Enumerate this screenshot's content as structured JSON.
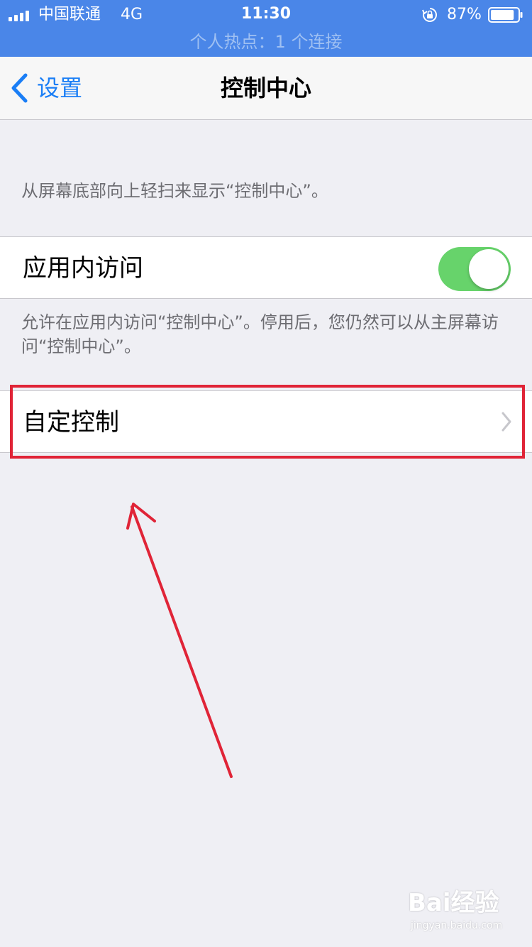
{
  "status_bar": {
    "carrier": "中国联通",
    "network": "4G",
    "time": "11:30",
    "battery_percent": "87%",
    "battery_level": 0.87,
    "hotspot_text": "个人热点：1 个连接",
    "icons": [
      "signal-icon",
      "rotation-lock-icon",
      "battery-icon"
    ]
  },
  "nav_bar": {
    "back_label": "设置",
    "title": "控制中心",
    "back_icon": "chevron-left-icon"
  },
  "content": {
    "header_note": "从屏幕底部向上轻扫来显示“控制中心”。",
    "access_within_apps": {
      "label": "应用内访问",
      "enabled": true,
      "footer": "允许在应用内访问“控制中心”。停用后，您仍然可以从主屏幕访问“控制中心”。"
    },
    "customize_controls": {
      "label": "自定控制",
      "icon": "chevron-right-icon"
    }
  },
  "colors": {
    "status_bar_bg": "#4a86e8",
    "accent_blue": "#1a7ef6",
    "toggle_on": "#67d36b",
    "background": "#efeff4",
    "annotation_red": "#e02437"
  },
  "watermark": {
    "logo": "Bai经验",
    "url": "jingyan.baidu.com"
  }
}
